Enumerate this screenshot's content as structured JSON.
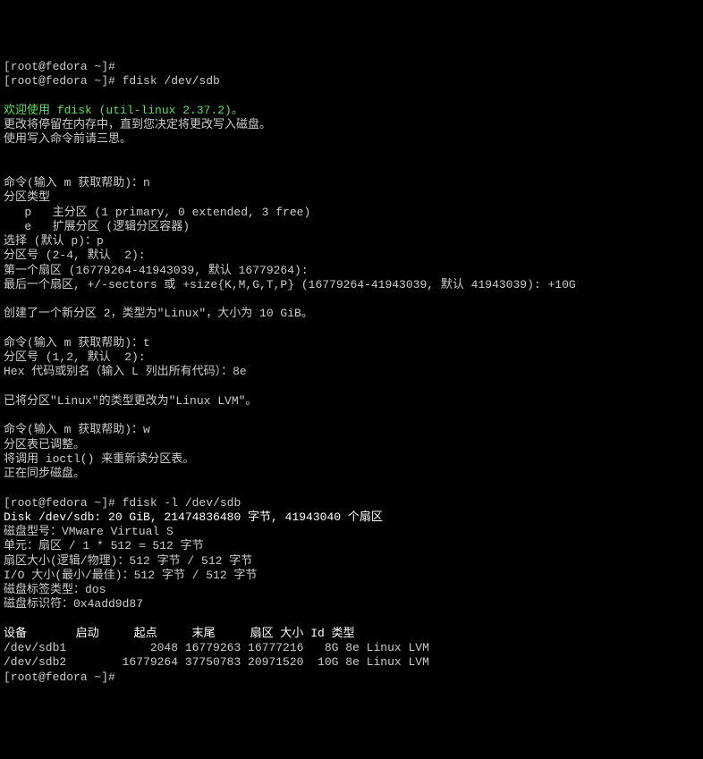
{
  "l00": "[root@fedora ~]#",
  "l01": "[root@fedora ~]# fdisk /dev/sdb",
  "l02": "",
  "l03": "欢迎使用 fdisk (util-linux 2.37.2)。",
  "l04": "更改将停留在内存中，直到您决定将更改写入磁盘。",
  "l05": "使用写入命令前请三思。",
  "l06": "",
  "l07": "",
  "l08": "命令(输入 m 获取帮助)：n",
  "l09": "分区类型",
  "l10": "   p   主分区 (1 primary, 0 extended, 3 free)",
  "l11": "   e   扩展分区 (逻辑分区容器)",
  "l12": "选择 (默认 p)：p",
  "l13": "分区号 (2-4, 默认  2):",
  "l14": "第一个扇区 (16779264-41943039, 默认 16779264):",
  "l15": "最后一个扇区, +/-sectors 或 +size{K,M,G,T,P} (16779264-41943039, 默认 41943039): +10G",
  "l16": "",
  "l17": "创建了一个新分区 2，类型为\"Linux\"，大小为 10 GiB。",
  "l18": "",
  "l19": "命令(输入 m 获取帮助)：t",
  "l20": "分区号 (1,2, 默认  2):",
  "l21": "Hex 代码或别名（输入 L 列出所有代码）：8e",
  "l22": "",
  "l23": "已将分区\"Linux\"的类型更改为\"Linux LVM\"。",
  "l24": "",
  "l25": "命令(输入 m 获取帮助)：w",
  "l26": "分区表已调整。",
  "l27": "将调用 ioctl() 来重新读分区表。",
  "l28": "正在同步磁盘。",
  "l29": "",
  "l30": "[root@fedora ~]# fdisk -l /dev/sdb",
  "l31": "Disk /dev/sdb: 20 GiB, 21474836480 字节, 41943040 个扇区",
  "l32": "磁盘型号：VMware Virtual S",
  "l33": "单元：扇区 / 1 * 512 = 512 字节",
  "l34": "扇区大小(逻辑/物理)：512 字节 / 512 字节",
  "l35": "I/O 大小(最小/最佳)：512 字节 / 512 字节",
  "l36": "磁盘标签类型：dos",
  "l37": "磁盘标识符：0x4add9d87",
  "l38": "",
  "l39": "设备       启动     起点     末尾     扇区 大小 Id 类型",
  "l40": "/dev/sdb1            2048 16779263 16777216   8G 8e Linux LVM",
  "l41": "/dev/sdb2        16779264 37750783 20971520  10G 8e Linux LVM",
  "l42": "[root@fedora ~]#"
}
